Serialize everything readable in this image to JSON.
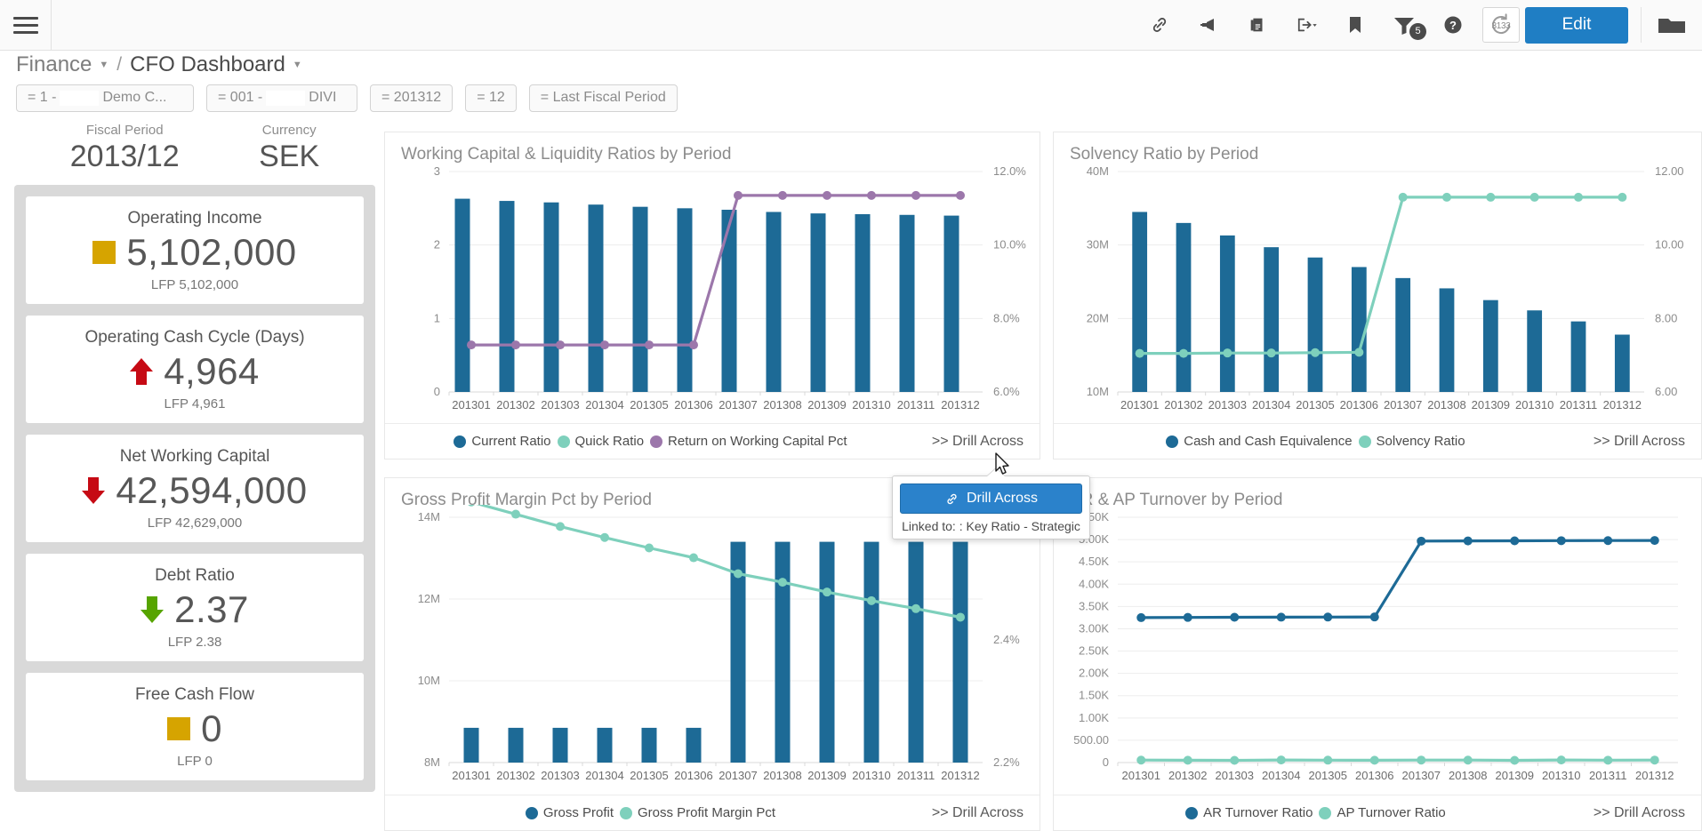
{
  "topbar": {
    "menu_icon": "hamburger-icon",
    "icons": [
      {
        "name": "link-icon",
        "title": "Link"
      },
      {
        "name": "megaphone-icon",
        "title": "Announce"
      },
      {
        "name": "copy-icon",
        "title": "Copy"
      },
      {
        "name": "export-icon",
        "title": "Export"
      },
      {
        "name": "bookmark-icon",
        "title": "Bookmark"
      },
      {
        "name": "filter-icon",
        "title": "Filters"
      },
      {
        "name": "help-icon",
        "title": "Help"
      }
    ],
    "filter_badge": "5",
    "refresh_value": "3133",
    "edit_label": "Edit",
    "folder_icon": "folder-icon"
  },
  "breadcrumb": {
    "root": "Finance",
    "separator": "/",
    "page": "CFO Dashboard"
  },
  "filters": [
    {
      "prefix": "= 1 -",
      "value": "Demo C..."
    },
    {
      "prefix": "= 001 -",
      "value": "DIVI"
    },
    {
      "prefix": "= 201312",
      "value": ""
    },
    {
      "prefix": "= 12",
      "value": ""
    },
    {
      "prefix": "= Last Fiscal Period",
      "value": ""
    }
  ],
  "header_stats": [
    {
      "label": "Fiscal Period",
      "value": "2013/12"
    },
    {
      "label": "Currency",
      "value": "SEK"
    }
  ],
  "kpis": [
    {
      "title": "Operating Income",
      "value": "5,102,000",
      "indicator": "square-flat",
      "color": "#d6a400",
      "sub": "LFP 5,102,000"
    },
    {
      "title": "Operating Cash Cycle (Days)",
      "value": "4,964",
      "indicator": "arrow-up",
      "color": "#c60a14",
      "sub": "LFP 4,961"
    },
    {
      "title": "Net Working Capital",
      "value": "42,594,000",
      "indicator": "arrow-down",
      "color": "#c60a14",
      "sub": "LFP 42,629,000"
    },
    {
      "title": "Debt Ratio",
      "value": "2.37",
      "indicator": "arrow-down",
      "color": "#56a400",
      "sub": "LFP 2.38"
    },
    {
      "title": "Free Cash Flow",
      "value": "0",
      "indicator": "square-flat",
      "color": "#d6a400",
      "sub": "LFP 0"
    }
  ],
  "popup": {
    "button_label": "Drill Across",
    "link_icon": "link-icon",
    "linked_text": "Linked to: : Key Ratio - Strategic"
  },
  "drill_label": ">> Drill Across",
  "colors": {
    "bar_blue": "#1d6a96",
    "teal": "#7ed0bc",
    "purple": "#9c77ab",
    "dark_blue": "#1d6a96",
    "accent": "#1f7ec4"
  },
  "chart_data": [
    {
      "id": "working-capital",
      "type": "bar",
      "title": "Working Capital & Liquidity Ratios by Period",
      "xlabel": "",
      "ylabel": "",
      "grid": true,
      "legend_position": "bottom",
      "categories": [
        "201301",
        "201302",
        "201303",
        "201304",
        "201305",
        "201306",
        "201307",
        "201308",
        "201309",
        "201310",
        "201311",
        "201312"
      ],
      "ylim": [
        0,
        3
      ],
      "yticks": [
        "0",
        "1",
        "2",
        "3"
      ],
      "y2lim": [
        6.0,
        12.0
      ],
      "y2ticks": [
        "6.0%",
        "8.0%",
        "10.0%",
        "12.0%"
      ],
      "series": [
        {
          "name": "Current Ratio",
          "type": "bar",
          "color": "#1d6a96",
          "axis": "left",
          "values": [
            2.63,
            2.6,
            2.58,
            2.55,
            2.52,
            2.5,
            2.48,
            2.45,
            2.43,
            2.42,
            2.41,
            2.4
          ]
        },
        {
          "name": "Quick Ratio",
          "type": "bar",
          "color": "#7ed0bc",
          "axis": "left",
          "values": [
            0,
            0,
            0,
            0,
            0,
            0,
            0,
            0,
            0,
            0,
            0,
            0
          ]
        },
        {
          "name": "Return on Working Capital Pct",
          "type": "line",
          "color": "#9c77ab",
          "axis": "right",
          "values": [
            7.28,
            7.28,
            7.28,
            7.28,
            7.28,
            7.28,
            11.35,
            11.35,
            11.35,
            11.35,
            11.35,
            11.35
          ]
        }
      ]
    },
    {
      "id": "solvency-ratio",
      "type": "bar",
      "title": "Solvency Ratio by Period",
      "xlabel": "",
      "ylabel": "",
      "grid": true,
      "legend_position": "bottom",
      "categories": [
        "201301",
        "201302",
        "201303",
        "201304",
        "201305",
        "201306",
        "201307",
        "201308",
        "201309",
        "201310",
        "201311",
        "201312"
      ],
      "ylim": [
        10000000,
        40000000
      ],
      "yticks": [
        "10M",
        "20M",
        "30M",
        "40M"
      ],
      "y2lim": [
        6.0,
        12.0
      ],
      "y2ticks": [
        "6.00",
        "8.00",
        "10.00",
        "12.00"
      ],
      "series": [
        {
          "name": "Cash and Cash Equivalence",
          "type": "bar",
          "color": "#1d6a96",
          "axis": "left",
          "values": [
            34500000,
            33000000,
            31300000,
            29700000,
            28300000,
            27000000,
            25500000,
            24100000,
            22500000,
            21100000,
            19600000,
            17800000
          ]
        },
        {
          "name": "Solvency Ratio",
          "type": "line",
          "color": "#7ed0bc",
          "axis": "right",
          "values": [
            7.05,
            7.05,
            7.06,
            7.06,
            7.07,
            7.08,
            11.3,
            11.3,
            11.3,
            11.3,
            11.3,
            11.3
          ]
        }
      ]
    },
    {
      "id": "gross-profit-margin",
      "type": "bar",
      "title": "Gross Profit Margin Pct by Period",
      "xlabel": "",
      "ylabel": "",
      "grid": true,
      "legend_position": "bottom",
      "categories": [
        "201301",
        "201302",
        "201303",
        "201304",
        "201305",
        "201306",
        "201307",
        "201308",
        "201309",
        "201310",
        "201311",
        "201312"
      ],
      "ylim": [
        8000000,
        14000000
      ],
      "yticks": [
        "8M",
        "10M",
        "12M",
        "14M"
      ],
      "y2lim": [
        2.2,
        2.6
      ],
      "y2ticks": [
        "2.2%",
        "2.4%",
        "2.6%"
      ],
      "series": [
        {
          "name": "Gross Profit",
          "type": "bar",
          "color": "#1d6a96",
          "axis": "left",
          "values": [
            8850000,
            8850000,
            8850000,
            8850000,
            8850000,
            8850000,
            13400000,
            13400000,
            13400000,
            13400000,
            13400000,
            13400000
          ]
        },
        {
          "name": "Gross Profit Margin Pct",
          "type": "line",
          "color": "#7ed0bc",
          "axis": "right",
          "values": [
            2.625,
            2.605,
            2.585,
            2.567,
            2.55,
            2.534,
            2.508,
            2.494,
            2.478,
            2.464,
            2.451,
            2.437
          ]
        }
      ]
    },
    {
      "id": "ar-ap-turnover",
      "type": "line",
      "title": "AR & AP Turnover by Period",
      "xlabel": "",
      "ylabel": "",
      "grid": true,
      "legend_position": "bottom",
      "categories": [
        "201301",
        "201302",
        "201303",
        "201304",
        "201305",
        "201306",
        "201307",
        "201308",
        "201309",
        "201310",
        "201311",
        "201312"
      ],
      "ylim": [
        0,
        5500
      ],
      "yticks": [
        "0",
        "500.00",
        "1.00K",
        "1.50K",
        "2.00K",
        "2.50K",
        "3.00K",
        "3.50K",
        "4.00K",
        "4.50K",
        "5.00K",
        "5.50K"
      ],
      "series": [
        {
          "name": "AR Turnover Ratio",
          "type": "line",
          "color": "#1d6a96",
          "axis": "left",
          "values": [
            3250,
            3255,
            3258,
            3260,
            3262,
            3265,
            4965,
            4970,
            4972,
            4975,
            4977,
            4980
          ]
        },
        {
          "name": "AP Turnover Ratio",
          "type": "line",
          "color": "#7ed0bc",
          "axis": "left",
          "values": [
            55,
            52,
            50,
            58,
            54,
            52,
            56,
            55,
            50,
            57,
            53,
            56
          ]
        }
      ]
    }
  ]
}
